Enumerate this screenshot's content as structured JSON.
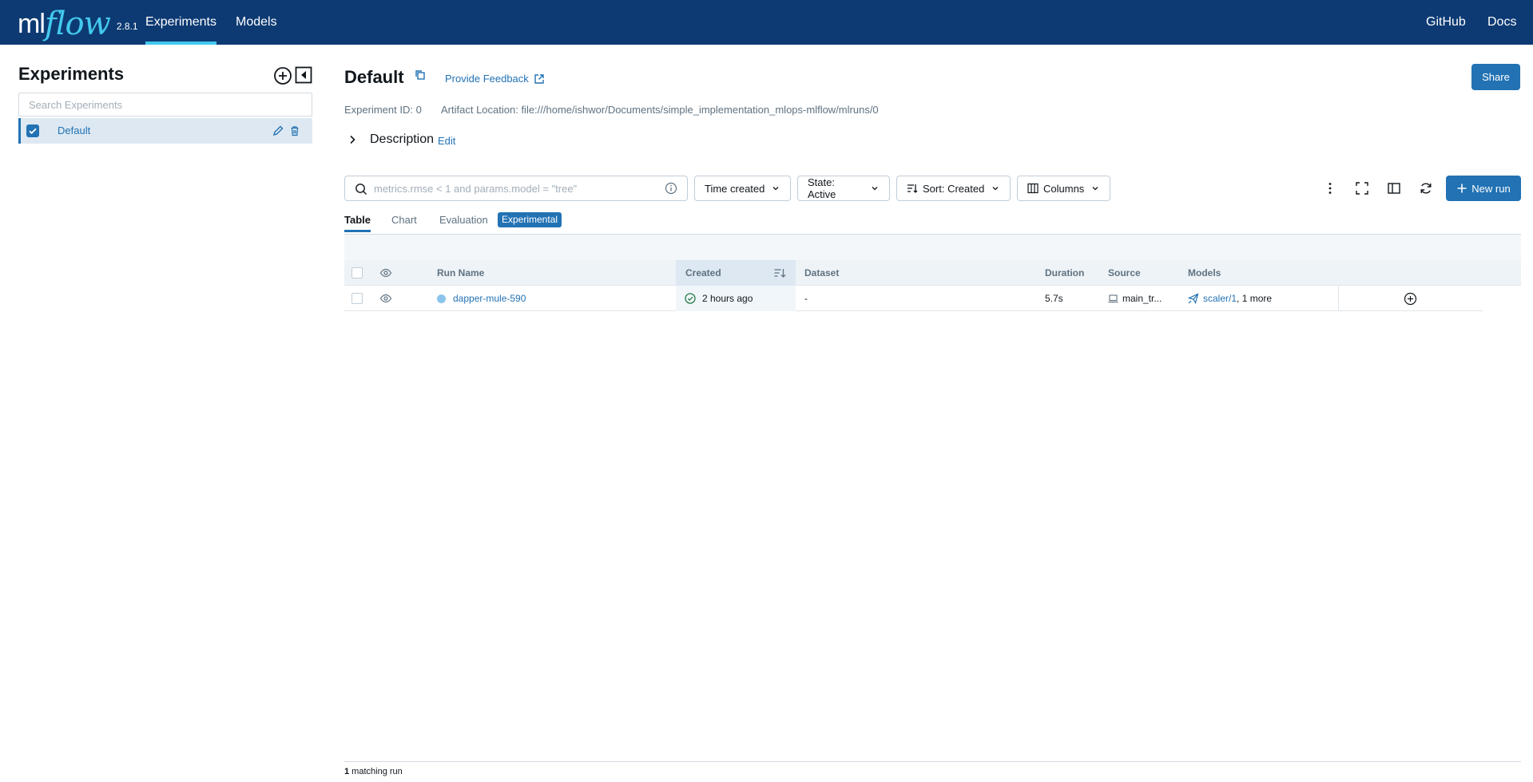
{
  "nav": {
    "logo_ml": "ml",
    "logo_flow": "flow",
    "version": "2.8.1",
    "experiments": "Experiments",
    "models": "Models",
    "github": "GitHub",
    "docs": "Docs"
  },
  "sidebar": {
    "title": "Experiments",
    "search_placeholder": "Search Experiments",
    "items": [
      {
        "label": "Default",
        "checked": true
      }
    ]
  },
  "header": {
    "title": "Default",
    "feedback": "Provide Feedback",
    "share": "Share",
    "experiment_id": "Experiment ID: 0",
    "artifact_location": "Artifact Location: file:///home/ishwor/Documents/simple_implementation_mlops-mlflow/mlruns/0",
    "description": "Description",
    "edit": "Edit"
  },
  "toolbar": {
    "search_placeholder": "metrics.rmse < 1 and params.model = \"tree\"",
    "time_created": "Time created",
    "state": "State: Active",
    "sort": "Sort: Created",
    "columns": "Columns",
    "new_run": "New run"
  },
  "tabs": {
    "table": "Table",
    "chart": "Chart",
    "evaluation": "Evaluation",
    "experimental": "Experimental"
  },
  "table": {
    "headers": {
      "run_name": "Run Name",
      "created": "Created",
      "dataset": "Dataset",
      "duration": "Duration",
      "source": "Source",
      "models": "Models"
    },
    "rows": [
      {
        "run_name": "dapper-mule-590",
        "created": "2 hours ago",
        "dataset": "-",
        "duration": "5.7s",
        "source": "main_tr...",
        "model_link": "scaler/1",
        "model_more": ", 1 more"
      }
    ]
  },
  "footer": {
    "count": "1",
    "text": " matching run"
  },
  "colors": {
    "nav_bg": "#0d3a73",
    "accent": "#2272b4",
    "logo_flow": "#43c9ed",
    "success": "#277c43"
  },
  "icons": [
    "add-experiment-icon",
    "collapse-sidebar-icon",
    "edit-icon",
    "trash-icon",
    "copy-icon",
    "external-link-icon",
    "chevron-right-icon",
    "search-icon",
    "info-icon",
    "chevron-down-icon",
    "sort-icon",
    "columns-icon",
    "kebab-icon",
    "fullscreen-icon",
    "sidebar-toggle-icon",
    "refresh-icon",
    "plus-icon",
    "eye-icon",
    "check-circle-icon",
    "laptop-icon",
    "model-icon",
    "add-column-icon"
  ]
}
